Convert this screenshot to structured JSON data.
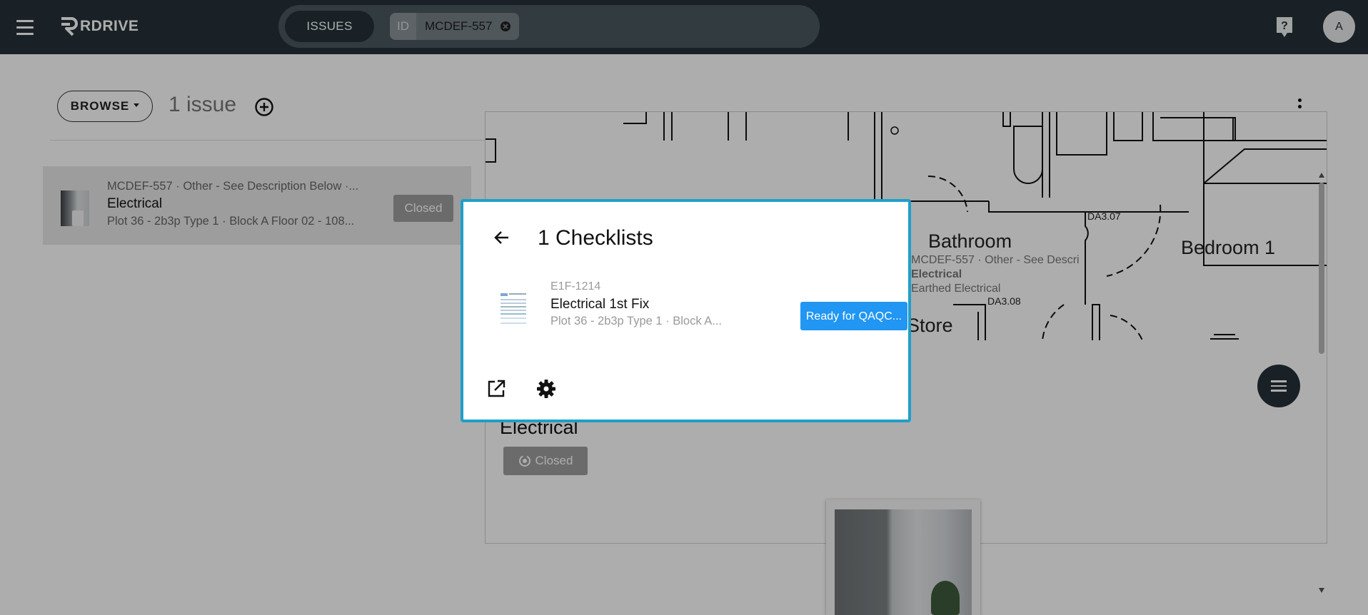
{
  "app": {
    "logo_text": "RDRIVE",
    "avatar_initial": "A"
  },
  "search": {
    "scope_label": "ISSUES",
    "filter_key": "ID",
    "filter_value": "MCDEF-557"
  },
  "toolbar": {
    "browse_label": "BROWSE",
    "issue_count": "1 issue"
  },
  "issue_card": {
    "meta": "MCDEF-557 · Other - See Description Below ·...",
    "title": "Electrical",
    "subtitle": "Plot 36 - 2b3p Type 1 · Block A Floor 02 - 108...",
    "status": "Closed"
  },
  "plan": {
    "labels": [
      "Bathroom",
      "Bedroom 1",
      "Store"
    ],
    "tags": [
      "DA3.07",
      "DA3.08"
    ],
    "pin": {
      "line1": "MCDEF-557 · Other - See Descri",
      "line2": "Electrical",
      "line3": "Earthed Electrical"
    }
  },
  "detail": {
    "title": "Electrical",
    "status": "Closed"
  },
  "dialog": {
    "title": "1 Checklists",
    "checklist": {
      "code": "E1F-1214",
      "title": "Electrical 1st Fix",
      "subtitle": "Plot 36 - 2b3p Type 1 · Block A...",
      "status_label": "Ready for QAQC..."
    }
  },
  "colors": {
    "topbar": "#263238",
    "accent": "#1f9fc8",
    "status_button": "#2196f3",
    "closed_badge": "#9e9e9e"
  }
}
